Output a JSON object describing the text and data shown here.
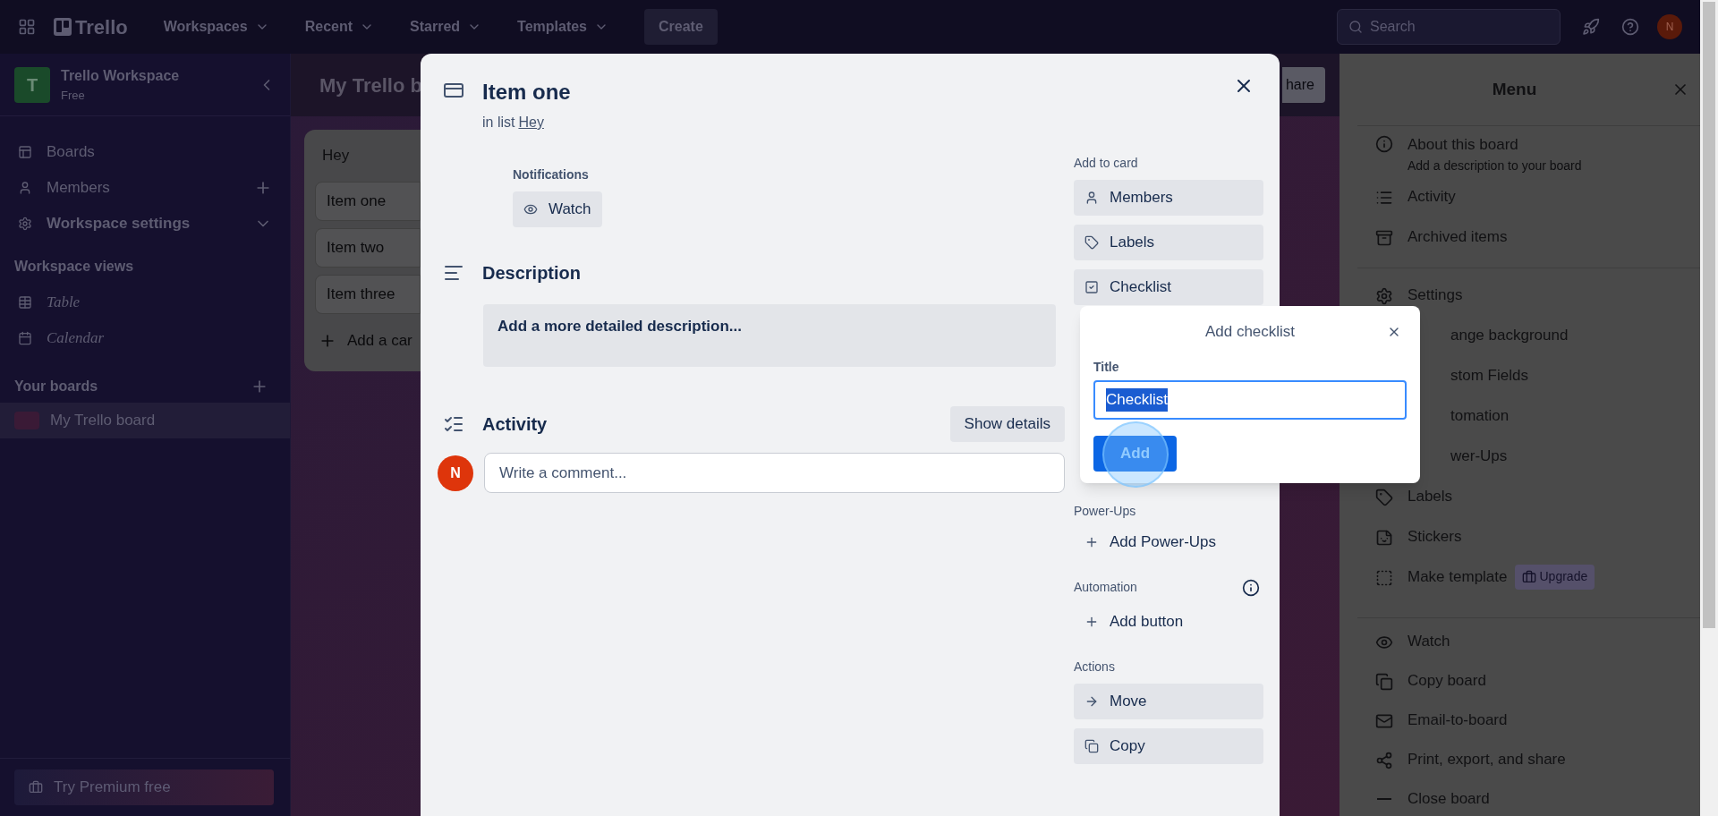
{
  "topbar": {
    "logo": "Trello",
    "nav": [
      {
        "label": "Workspaces"
      },
      {
        "label": "Recent"
      },
      {
        "label": "Starred"
      },
      {
        "label": "Templates"
      }
    ],
    "create": "Create",
    "search": {
      "placeholder": "Search"
    },
    "avatar": "N"
  },
  "sidebar": {
    "workspace": {
      "initial": "T",
      "name": "Trello Workspace",
      "plan": "Free"
    },
    "items": [
      {
        "label": "Boards",
        "kind": "plain"
      },
      {
        "label": "Members",
        "kind": "addable"
      },
      {
        "label": "Workspace settings",
        "kind": "expandable"
      }
    ],
    "views_heading": "Workspace views",
    "views": [
      {
        "label": "Table"
      },
      {
        "label": "Calendar"
      }
    ],
    "boards_heading": "Your boards",
    "boards": [
      {
        "label": "My Trello board",
        "selected": true
      }
    ],
    "premium": "Try Premium free"
  },
  "board": {
    "title": "My Trello b",
    "share": "hare",
    "list": {
      "title": "Hey",
      "cards": [
        "Item one",
        "Item two",
        "Item three"
      ],
      "add": "Add a car"
    }
  },
  "card_dialog": {
    "title": "Item one",
    "in_list": "in list",
    "list_link": "Hey",
    "notifications_label": "Notifications",
    "watch": "Watch",
    "description_heading": "Description",
    "description_placeholder": "Add a more detailed description...",
    "activity_heading": "Activity",
    "show_details": "Show details",
    "comment_avatar": "N",
    "comment_placeholder": "Write a comment...",
    "add_to_card_label": "Add to card",
    "add_to_card": [
      "Members",
      "Labels",
      "Checklist"
    ],
    "powerups_label": "Power-Ups",
    "add_powerups": "Add Power-Ups",
    "automation_label": "Automation",
    "add_button": "Add button",
    "actions_label": "Actions",
    "actions": [
      "Move",
      "Copy"
    ]
  },
  "checklist_popover": {
    "title": "Add checklist",
    "field_label": "Title",
    "value": "Checklist",
    "text_selected": true,
    "submit": "Add"
  },
  "menu": {
    "title": "Menu",
    "sections": [
      [
        {
          "label": "About this board",
          "subtitle": "Add a description to your board",
          "covered": false
        },
        {
          "label": "Activity",
          "covered": false
        },
        {
          "label": "Archived items",
          "covered": false
        }
      ],
      [
        {
          "label": "Settings",
          "covered": false
        },
        {
          "label": "ange background",
          "covered": true
        },
        {
          "label": "stom Fields",
          "covered": true
        },
        {
          "label": "tomation",
          "covered": true
        },
        {
          "label": "wer-Ups",
          "covered": true
        },
        {
          "label": "Labels",
          "covered": false
        },
        {
          "label": "Stickers",
          "covered": false
        },
        {
          "label": "Make template",
          "badge": "Upgrade",
          "covered": false
        }
      ],
      [
        {
          "label": "Watch",
          "covered": false
        },
        {
          "label": "Copy board",
          "covered": false
        },
        {
          "label": "Email-to-board",
          "covered": false
        },
        {
          "label": "Print, export, and share",
          "covered": false
        },
        {
          "label": "Close board",
          "covered": false
        }
      ]
    ]
  }
}
